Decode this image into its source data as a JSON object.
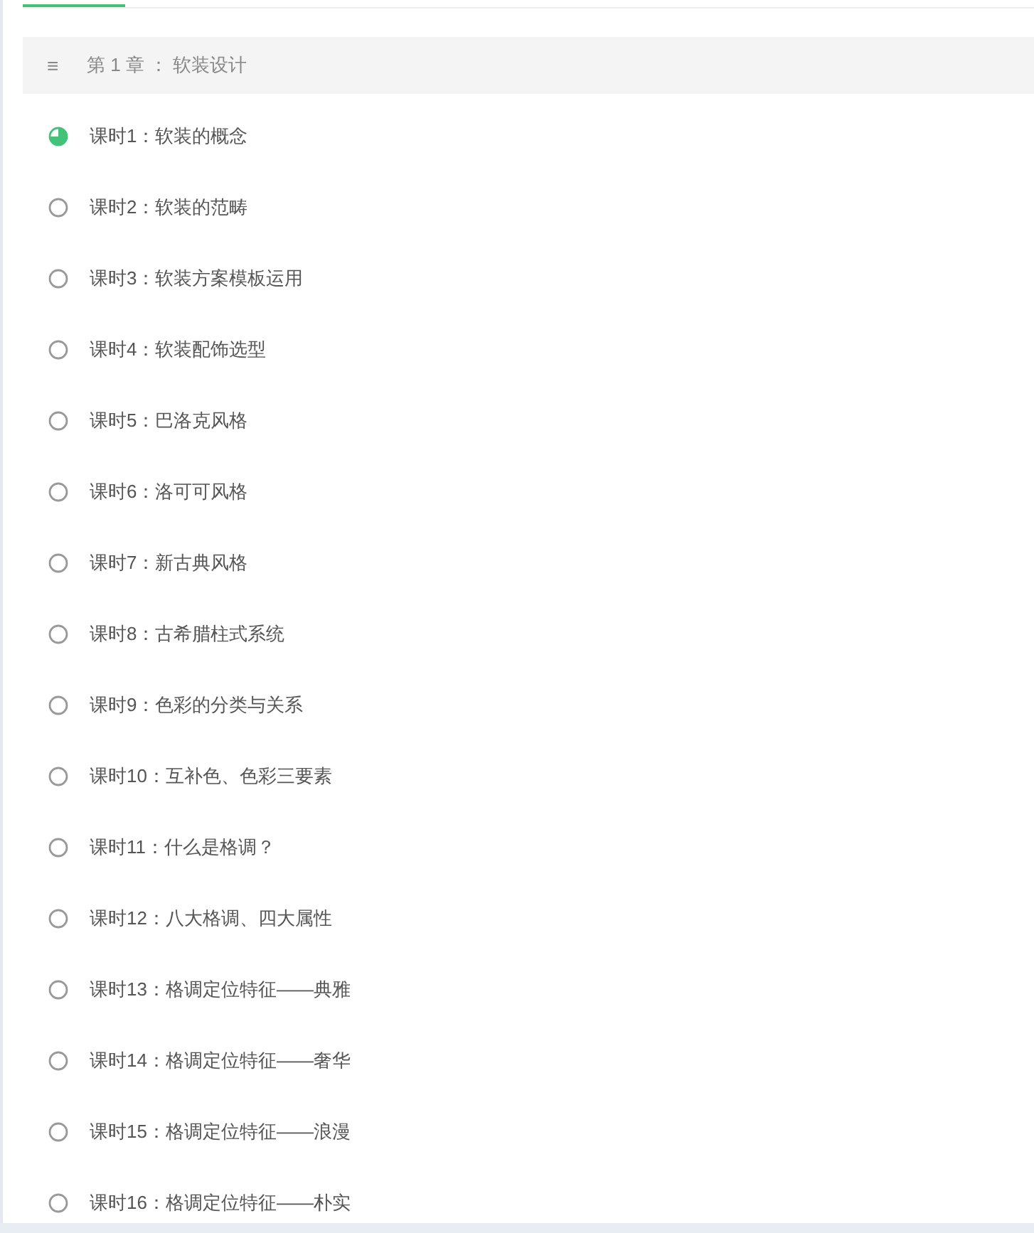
{
  "chapter": {
    "icon": "≡",
    "title": "第 1 章 ： 软装设计"
  },
  "lessons": [
    {
      "title": "课时1：软装的概念",
      "started": true
    },
    {
      "title": "课时2：软装的范畴",
      "started": false
    },
    {
      "title": "课时3：软装方案模板运用",
      "started": false
    },
    {
      "title": "课时4：软装配饰选型",
      "started": false
    },
    {
      "title": "课时5：巴洛克风格",
      "started": false
    },
    {
      "title": "课时6：洛可可风格",
      "started": false
    },
    {
      "title": "课时7：新古典风格",
      "started": false
    },
    {
      "title": "课时8：古希腊柱式系统",
      "started": false
    },
    {
      "title": "课时9：色彩的分类与关系",
      "started": false
    },
    {
      "title": "课时10：互补色、色彩三要素",
      "started": false
    },
    {
      "title": "课时11：什么是格调？",
      "started": false
    },
    {
      "title": "课时12：八大格调、四大属性",
      "started": false
    },
    {
      "title": "课时13：格调定位特征——典雅",
      "started": false
    },
    {
      "title": "课时14：格调定位特征——奢华",
      "started": false
    },
    {
      "title": "课时15：格调定位特征——浪漫",
      "started": false
    },
    {
      "title": "课时16：格调定位特征——朴实",
      "started": false
    }
  ]
}
